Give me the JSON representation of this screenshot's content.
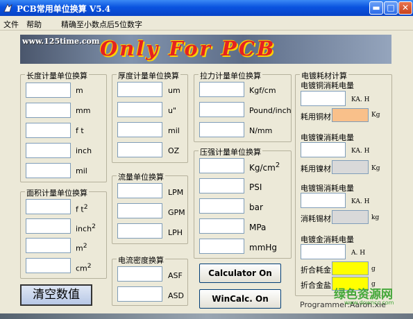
{
  "window": {
    "title": "PCB常用单位换算 V5.4"
  },
  "menu": {
    "file": "文件",
    "help": "帮助",
    "precision": "精确至小数点后5位数字"
  },
  "banner": {
    "url": "www.125time.com",
    "slogan": "Only For PCB"
  },
  "length": {
    "title": "长度计量单位换算",
    "units": [
      "m",
      "mm",
      "f t",
      "inch",
      "mil"
    ]
  },
  "area": {
    "title": "面积计量单位换算",
    "units": [
      "f t",
      "inch",
      "m",
      "cm"
    ],
    "sup": "2"
  },
  "thickness": {
    "title": "厚度计量单位换算",
    "units": [
      "um",
      "u\"",
      "mil",
      "OZ"
    ]
  },
  "flow": {
    "title": "流量单位换算",
    "units": [
      "LPM",
      "GPM",
      "LPH"
    ]
  },
  "current": {
    "title": "电流密度换算",
    "units": [
      "ASF",
      "ASD"
    ]
  },
  "force": {
    "title": "拉力计量单位换算",
    "units": [
      "Kgf/cm",
      "Pound/inch",
      "N/mm"
    ]
  },
  "pressure": {
    "title": "压强计量单位换算",
    "units": [
      "Kg/cm",
      "PSI",
      "bar",
      "MPa",
      "mmHg"
    ],
    "sup": "2"
  },
  "buttons": {
    "calculator": "Calculator On",
    "wincalc": "WinCalc. On",
    "clear": "清空数值"
  },
  "plating": {
    "title": "电镀耗材计算",
    "copper": {
      "label": "电镀铜消耗电量",
      "unit": "KA. H",
      "mat": "耗用铜材",
      "mat_unit": "Kg"
    },
    "nickel": {
      "label": "电镀镍消耗电量",
      "unit": "KA. H",
      "mat": "耗用镍材",
      "mat_unit": "Kg"
    },
    "tin": {
      "label": "电镀锡消耗电量",
      "unit": "KA. H",
      "mat": "消耗锡材",
      "mat_unit": "kg"
    },
    "gold": {
      "label": "电镀金消耗电量",
      "unit": "A. H"
    },
    "gold_salt": {
      "label": "折合耗金",
      "unit": "g"
    },
    "gold_total": {
      "label": "折合金盐",
      "unit": "g"
    }
  },
  "footer": {
    "credit": "Programmer:Aaron.xie",
    "watermark": "绿色资源网",
    "watermark_url": "www.downcc.com"
  },
  "colors": {
    "titlebar": "#0a53df",
    "window": "#ece9d8",
    "orange_field": "#f9c08a",
    "yellow_field": "#ffff00",
    "gray_field": "#d9d9d9",
    "slogan": "#e52222"
  }
}
